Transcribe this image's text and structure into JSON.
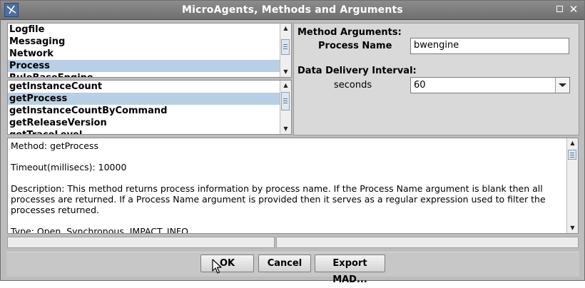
{
  "window": {
    "title": "MicroAgents, Methods and Arguments",
    "close_glyph": "✕"
  },
  "microagents": {
    "items": [
      "Logfile",
      "Messaging",
      "Network",
      "Process",
      "RuleBaseEngine"
    ],
    "selected": "Process"
  },
  "methods": {
    "items": [
      "getInstanceCount",
      "getProcess",
      "getInstanceCountByCommand",
      "getReleaseVersion",
      "getTraceLevel"
    ],
    "selected": "getProcess"
  },
  "arguments": {
    "heading": "Method Arguments:",
    "process_name_label": "Process Name",
    "process_name_value": "bwengine",
    "interval_heading": "Data Delivery Interval:",
    "seconds_label": "seconds",
    "seconds_value": "60"
  },
  "description": {
    "method": "Method: getProcess",
    "timeout": "Timeout(millisecs): 10000",
    "description": "Description: This method returns process information by process name. If the Process Name argument is blank then all processes are returned. If a Process Name argument is provided then it serves as a regular expression used to filter the processes returned.",
    "type": "Type: Open, Synchronous, IMPACT_INFO"
  },
  "buttons": {
    "ok": "OK",
    "cancel": "Cancel",
    "export": "Export MAD..."
  },
  "colors": {
    "selection": "#b8cfe5",
    "titlebar": "#7a7a7a"
  }
}
